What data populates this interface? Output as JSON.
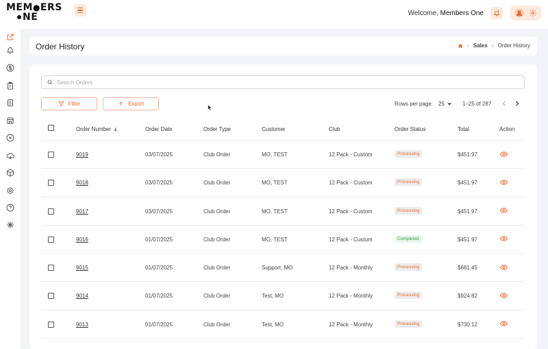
{
  "header": {
    "logo_line1": "MEM",
    "logo_mid": "ERS",
    "logo_line2": "NE",
    "welcome_prefix": "Welcome,",
    "welcome_name": "Members One"
  },
  "page": {
    "title": "Order History",
    "breadcrumb": [
      "Sales",
      "Order History"
    ]
  },
  "search": {
    "placeholder": "Search Orders",
    "value": ""
  },
  "toolbar": {
    "filter_label": "Filter",
    "export_label": "Export"
  },
  "pagination": {
    "rows_per_page_label": "Rows per page:",
    "rows_per_page": "25",
    "range": "1–25 of 287"
  },
  "table": {
    "columns": [
      "Order Number",
      "Order Date",
      "Order Type",
      "Customer",
      "Club",
      "Order Status",
      "Total",
      "Action"
    ],
    "rows": [
      {
        "number": "9019",
        "date": "03/07/2025",
        "type": "Club Order",
        "customer": "MO, TEST",
        "club": "12 Pack - Custom",
        "status": "Processing",
        "total": "$451.97"
      },
      {
        "number": "9018",
        "date": "03/07/2025",
        "type": "Club Order",
        "customer": "MO, TEST",
        "club": "12 Pack - Custom",
        "status": "Processing",
        "total": "$451.97"
      },
      {
        "number": "9017",
        "date": "03/07/2025",
        "type": "Club Order",
        "customer": "MO, TEST",
        "club": "12 Pack - Custom",
        "status": "Processing",
        "total": "$451.97"
      },
      {
        "number": "9016",
        "date": "01/07/2025",
        "type": "Club Order",
        "customer": "MO, TEST",
        "club": "12 Pack - Custom",
        "status": "Completed",
        "total": "$451.97"
      },
      {
        "number": "9015",
        "date": "01/07/2025",
        "type": "Club Order",
        "customer": "Support, MO",
        "club": "12 Pack - Monthly",
        "status": "Processing",
        "total": "$681.45"
      },
      {
        "number": "9014",
        "date": "01/07/2025",
        "type": "Club Order",
        "customer": "Test, MO",
        "club": "12 Pack - Monthly",
        "status": "Processing",
        "total": "$924.82"
      },
      {
        "number": "9013",
        "date": "01/07/2025",
        "type": "Club Order",
        "customer": "Test, MO",
        "club": "12 Pack - Monthly",
        "status": "Processing",
        "total": "$730.12"
      }
    ]
  },
  "colors": {
    "accent": "#e76a2c",
    "accent_light": "#fde9de",
    "success": "#2f9e4e"
  },
  "sidebar_icons": [
    "external-link-icon",
    "bell-icon",
    "dollar-icon",
    "clipboard-icon",
    "document-icon",
    "store-icon",
    "close-circle-icon",
    "cloud-icon",
    "box-icon",
    "settings-icon",
    "help-icon",
    "snowflake-icon"
  ]
}
